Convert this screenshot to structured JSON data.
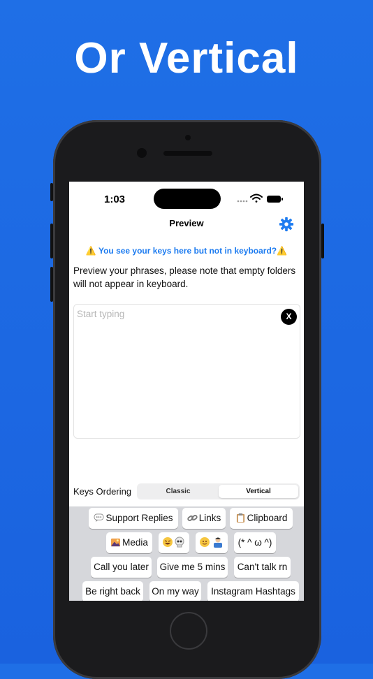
{
  "headline": "Or Vertical",
  "status": {
    "time": "1:03"
  },
  "nav": {
    "title": "Preview"
  },
  "warning": "⚠️ You see your keys here but not in keyboard?⚠️",
  "description": "Preview your phrases, please note that empty folders will not appear in keyboard.",
  "input": {
    "placeholder": "Start typing",
    "clear_label": "X"
  },
  "ordering": {
    "label": "Keys Ordering",
    "options": [
      "Classic",
      "Vertical"
    ],
    "selected": "Vertical"
  },
  "keys": {
    "row1": [
      "Support Replies",
      "Links",
      "Clipboard"
    ],
    "row2": [
      "Media",
      "",
      "",
      "(* ^ ω ^)"
    ],
    "row3": [
      "Call you later",
      "Give me 5 mins",
      "Can't talk rn"
    ],
    "row4": [
      "Be right back",
      "On my way",
      "Instagram Hashtags"
    ]
  },
  "icons": {
    "support": "speech-bubble-icon",
    "links": "link-icon",
    "clipboard": "clipboard-icon",
    "media": "picture-icon",
    "emoji_a": "laughing-skull-emoji-icon",
    "emoji_b": "smiling-person-emoji-icon",
    "settings": "gear-icon"
  },
  "colors": {
    "background": "#1f6fe6",
    "accent": "#1e7cf0",
    "keyboard": "#d6d7db"
  }
}
